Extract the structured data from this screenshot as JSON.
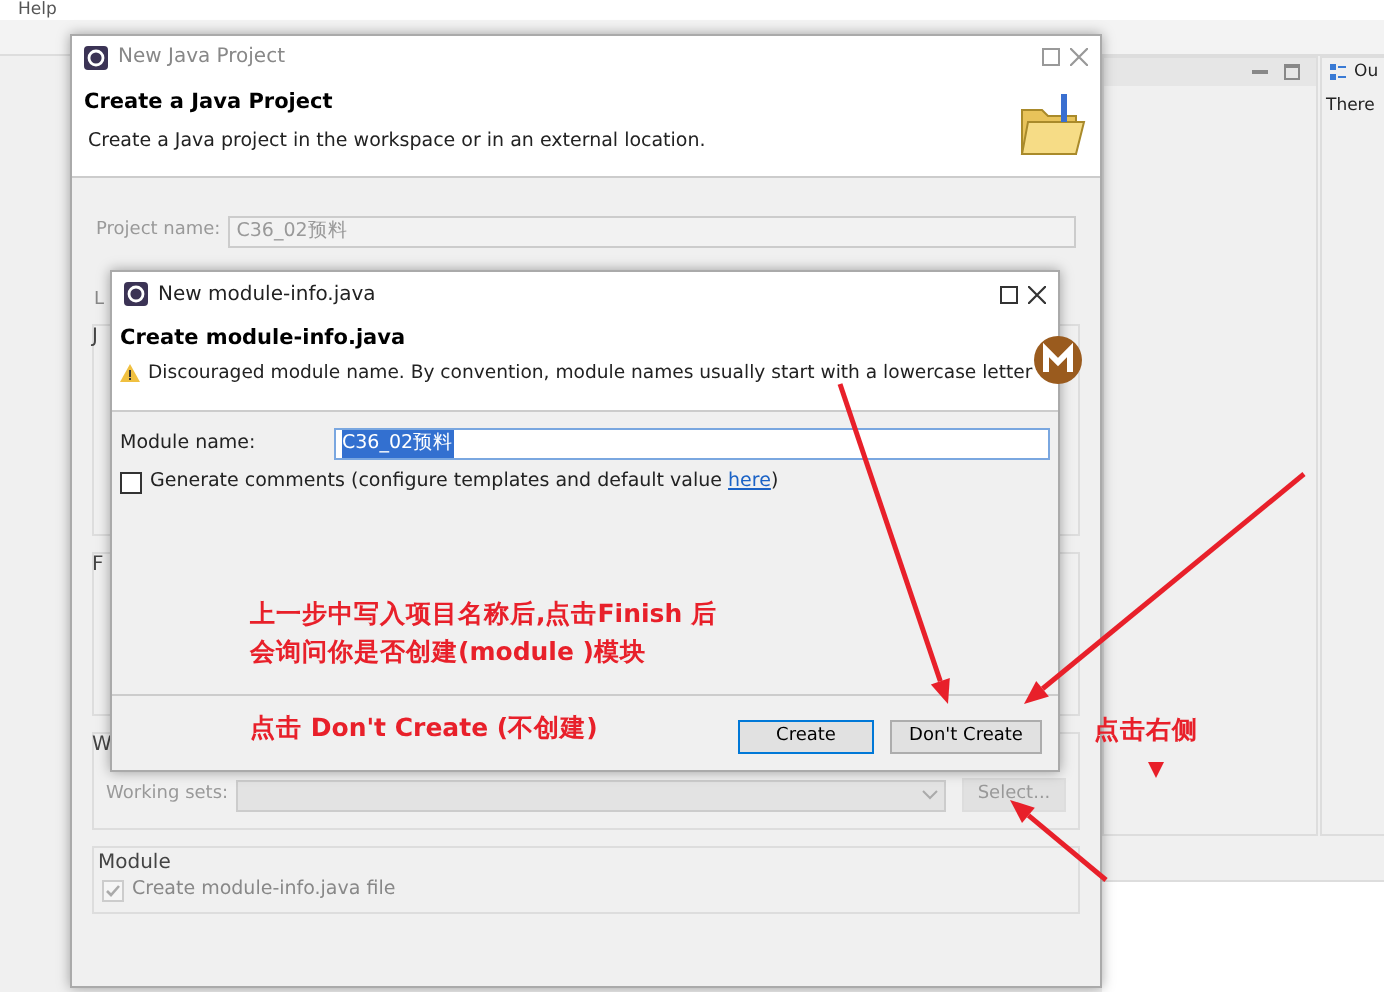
{
  "ide": {
    "menu": [
      "Help"
    ],
    "outline_panel": {
      "title": "Ou",
      "message": "There"
    }
  },
  "project_dialog": {
    "title": "New Java Project",
    "heading": "Create a Java Project",
    "description": "Create a Java project in the workspace or in an external location.",
    "project_name": {
      "label": "Project name:",
      "value": "C36_02预料",
      "disabled": true
    },
    "fragments": [
      "L",
      "J",
      "F",
      "W"
    ],
    "working_sets": {
      "label": "Working sets:",
      "disabled": true
    },
    "select_button": "Select...",
    "module_group": {
      "title": "Module",
      "checkbox": {
        "label": "Create module-info.java file",
        "checked": true,
        "disabled": true
      }
    }
  },
  "module_dialog": {
    "title": "New module-info.java",
    "heading": "Create module-info.java",
    "warning": "Discouraged module name. By convention, module names usually start with a lowercase letter",
    "module_name": {
      "label": "Module name:",
      "value": "C36_02预料",
      "selected": true
    },
    "generate_comments": {
      "label": "Generate comments (configure templates and default value ",
      "link": "here",
      "tail": ")",
      "checked": false
    },
    "buttons": [
      {
        "label": "Create",
        "default": true
      },
      {
        "label": "Don't Create",
        "default": false
      }
    ]
  },
  "annotations": {
    "steps_note": [
      "上一步中写入项目名称后,点击Finish 后",
      "会询问你是否创建(module )模块"
    ],
    "click_note": "点击 Don't Create (不创建)",
    "side_note": "点击右侧"
  }
}
